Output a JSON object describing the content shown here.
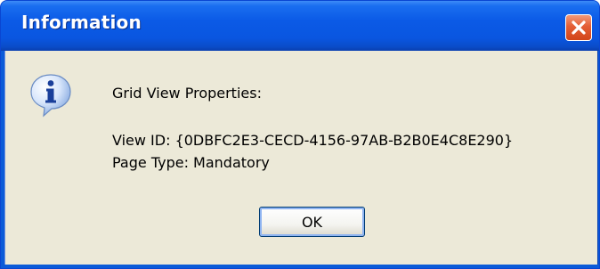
{
  "window": {
    "title": "Information",
    "close_icon": "close-icon",
    "title_bar_color": "#0b5ae6",
    "close_button_color": "#e45e35"
  },
  "dialog": {
    "icon": "info-icon",
    "heading": "Grid View Properties:",
    "view_id_line": "View ID: {0DBFC2E3-CECD-4156-97AB-B2B0E4C8E290}",
    "page_type_line": "Page Type: Mandatory",
    "body_color": "#ece9d8"
  },
  "buttons": {
    "ok_label": "OK"
  }
}
